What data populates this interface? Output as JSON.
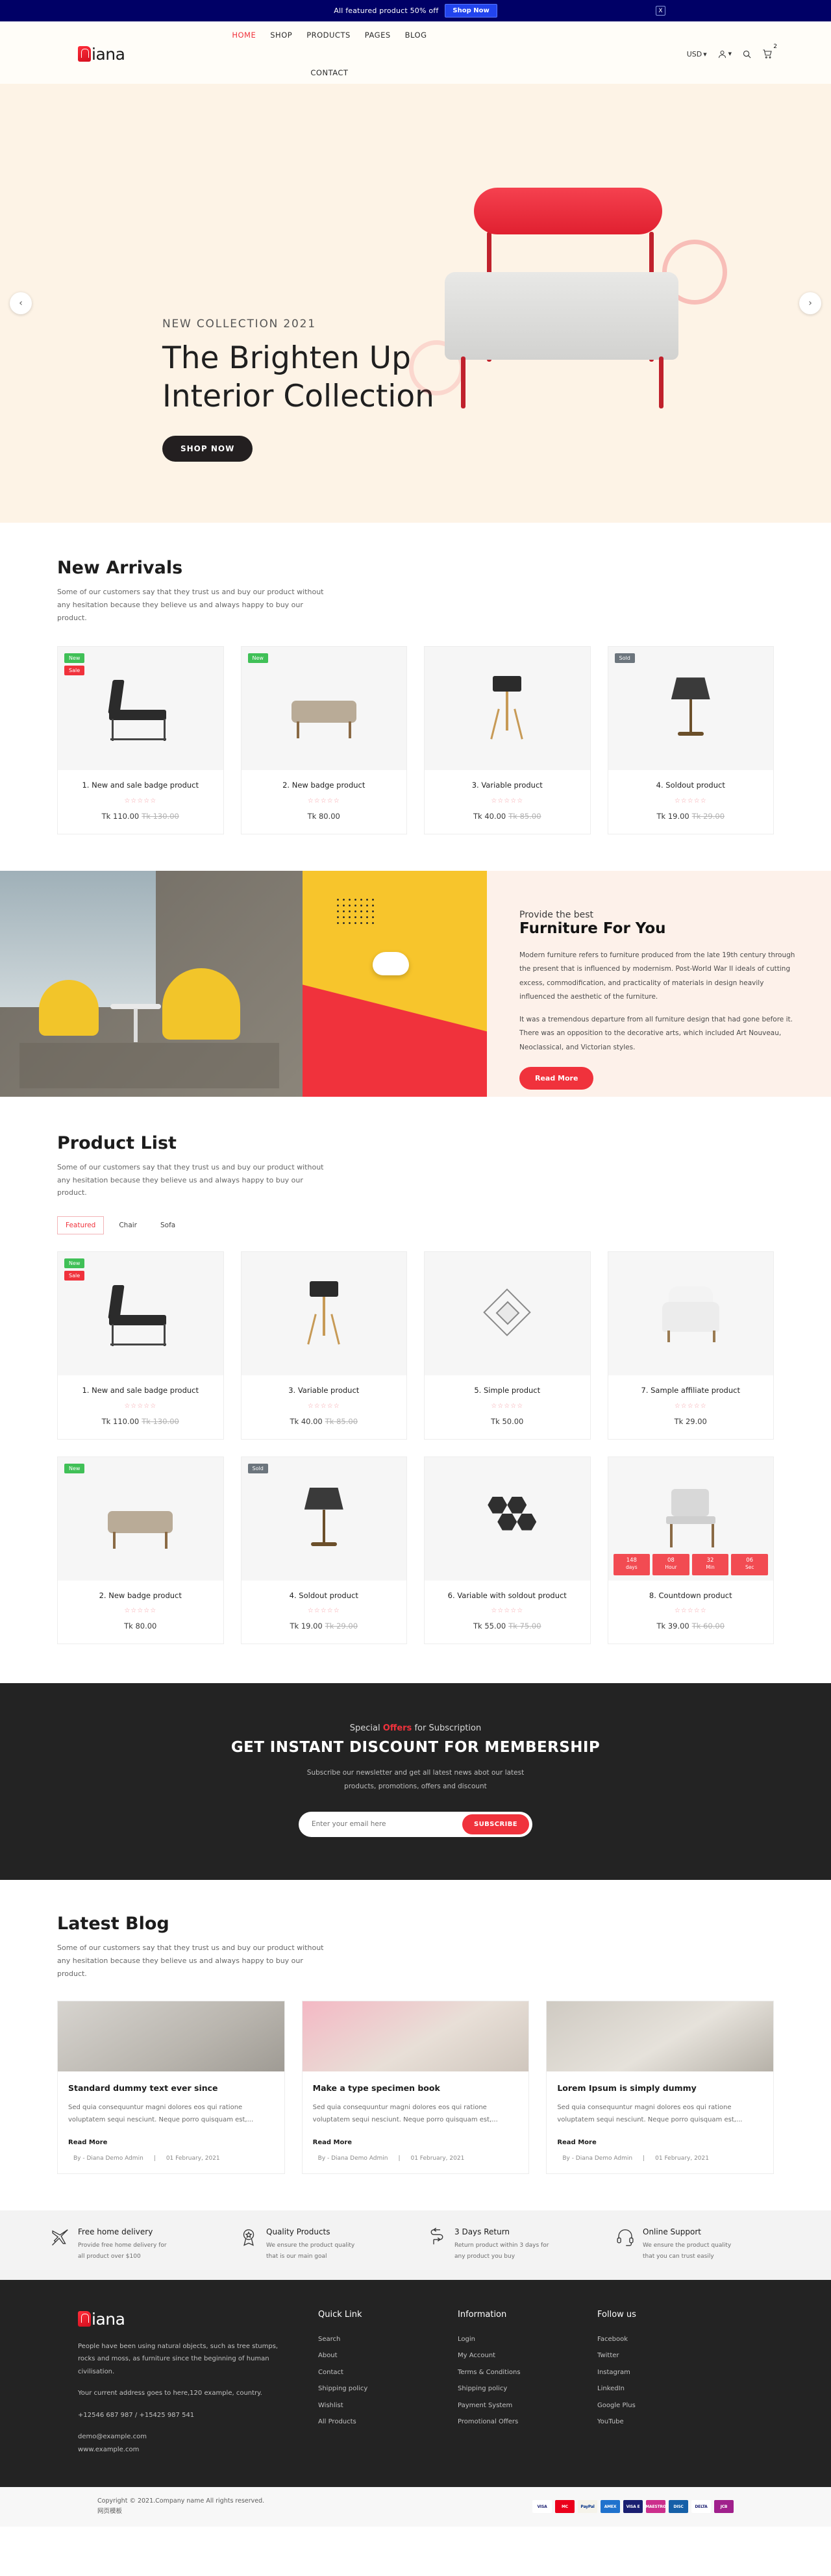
{
  "promo": {
    "text": "All featured product 50% off",
    "button": "Shop Now",
    "close": "X"
  },
  "header": {
    "logo": "iana",
    "nav": [
      {
        "label": "HOME",
        "active": true
      },
      {
        "label": "SHOP",
        "active": false
      },
      {
        "label": "PRODUCTS",
        "active": false
      },
      {
        "label": "PAGES",
        "active": false
      },
      {
        "label": "BLOG",
        "active": false
      },
      {
        "label": "CONTACT",
        "active": false
      }
    ],
    "currency": "USD",
    "cart_count": "2"
  },
  "hero": {
    "eyebrow": "NEW COLLECTION 2021",
    "title_line1": "The Brighten Up",
    "title_line2": "Interior Collection",
    "button": "SHOP NOW",
    "prev": "‹",
    "next": "›"
  },
  "new_arrivals": {
    "title": "New Arrivals",
    "subtitle": "Some of our customers say that they trust us and buy our product without any hesitation because they believe us and always happy to buy our product.",
    "products": [
      {
        "name": "1. New and sale badge product",
        "stars": "☆☆☆☆☆",
        "price": "Tk 110.00",
        "old_price": "Tk 130.00",
        "badges": [
          "New",
          "Sale"
        ]
      },
      {
        "name": "2. New badge product",
        "stars": "☆☆☆☆☆",
        "price": "Tk 80.00",
        "old_price": "",
        "badges": [
          "New"
        ]
      },
      {
        "name": "3. Variable product",
        "stars": "☆☆☆☆☆",
        "price": "Tk 40.00",
        "old_price": "Tk 85.00",
        "badges": []
      },
      {
        "name": "4. Soldout product",
        "stars": "☆☆☆☆☆",
        "price": "Tk 19.00",
        "old_price": "Tk 29.00",
        "badges": [
          "Sold"
        ]
      }
    ]
  },
  "about": {
    "eyebrow": "Provide the best",
    "title": "Furniture For You",
    "paragraph1": "Modern furniture refers to furniture produced from the late 19th century through the present that is influenced by modernism. Post-World War II ideals of cutting excess, commodification, and practicality of materials in design heavily influenced the aesthetic of the furniture.",
    "paragraph2": "It was a tremendous departure from all furniture design that had gone before it. There was an opposition to the decorative arts, which included Art Nouveau, Neoclassical, and Victorian styles.",
    "button": "Read More"
  },
  "product_list": {
    "title": "Product List",
    "subtitle": "Some of our customers say that they trust us and buy our product without any hesitation because they believe us and always happy to buy our product.",
    "tabs": [
      {
        "label": "Featured",
        "active": true
      },
      {
        "label": "Chair",
        "active": false
      },
      {
        "label": "Sofa",
        "active": false
      }
    ],
    "products": [
      {
        "name": "1. New and sale badge product",
        "stars": "☆☆☆☆☆",
        "price": "Tk 110.00",
        "old_price": "Tk 130.00"
      },
      {
        "name": "3. Variable product",
        "stars": "☆☆☆☆☆",
        "price": "Tk 40.00",
        "old_price": "Tk 85.00"
      },
      {
        "name": "5. Simple product",
        "stars": "☆☆☆☆☆",
        "price": "Tk 50.00",
        "old_price": ""
      },
      {
        "name": "7. Sample affiliate product",
        "stars": "☆☆☆☆☆",
        "price": "Tk 29.00",
        "old_price": ""
      },
      {
        "name": "2. New badge product",
        "stars": "☆☆☆☆☆",
        "price": "Tk 80.00",
        "old_price": ""
      },
      {
        "name": "4. Soldout product",
        "stars": "☆☆☆☆☆",
        "price": "Tk 19.00",
        "old_price": "Tk 29.00"
      },
      {
        "name": "6. Variable with soldout product",
        "stars": "☆☆☆☆☆",
        "price": "Tk 55.00",
        "old_price": "Tk 75.00"
      },
      {
        "name": "8. Countdown product",
        "stars": "☆☆☆☆☆",
        "price": "Tk 39.00",
        "old_price": "Tk 60.00"
      }
    ],
    "countdown": [
      {
        "num": "148",
        "label": "days"
      },
      {
        "num": "08",
        "label": "Hour"
      },
      {
        "num": "32",
        "label": "Min"
      },
      {
        "num": "06",
        "label": "Sec"
      }
    ]
  },
  "subscribe": {
    "eyebrow_pre": "Special ",
    "eyebrow_accent": "Offers",
    "eyebrow_post": " for Subscription",
    "title": "GET INSTANT DISCOUNT FOR MEMBERSHIP",
    "desc_line1": "Subscribe our newsletter and get all latest news abot our latest",
    "desc_line2": "products, promotions, offers and discount",
    "placeholder": "Enter your email here",
    "button": "SUBSCRIBE"
  },
  "blog": {
    "title": "Latest Blog",
    "subtitle": "Some of our customers say that they trust us and buy our product without any hesitation because they believe us and always happy to buy our product.",
    "read_more": "Read More",
    "posts": [
      {
        "title": "Standard dummy text ever since",
        "text": "Sed quia consequuntur magni dolores eos qui ratione voluptatem sequi nesciunt. Neque porro quisquam est,...",
        "author": "By - Diana Demo Admin",
        "date": "01 February, 2021"
      },
      {
        "title": "Make a type specimen book",
        "text": "Sed quia consequuntur magni dolores eos qui ratione voluptatem sequi nesciunt. Neque porro quisquam est,...",
        "author": "By - Diana Demo Admin",
        "date": "01 February, 2021"
      },
      {
        "title": "Lorem Ipsum is simply dummy",
        "text": "Sed quia consequuntur magni dolores eos qui ratione voluptatem sequi nesciunt. Neque porro quisquam est,...",
        "author": "By - Diana Demo Admin",
        "date": "01 February, 2021"
      }
    ]
  },
  "features": [
    {
      "icon": "plane-icon",
      "title": "Free home delivery",
      "line1": "Provide free home delivery for",
      "line2": "all product over $100"
    },
    {
      "icon": "award-icon",
      "title": "Quality Products",
      "line1": "We ensure the product quality",
      "line2": "that is our main goal"
    },
    {
      "icon": "return-icon",
      "title": "3 Days Return",
      "line1": "Return product within 3 days for",
      "line2": "any product you buy"
    },
    {
      "icon": "headset-icon",
      "title": "Online Support",
      "line1": "We ensure the product quality",
      "line2": "that you can trust easily"
    }
  ],
  "footer": {
    "logo": "iana",
    "about": "People have been using natural objects, such as tree stumps, rocks and moss, as furniture since the beginning of human civilisation.",
    "address": "Your current address goes to here,120 example, country.",
    "phone": "+12546 687 987 / +15425 987 541",
    "email": "demo@example.com",
    "website": "www.example.com",
    "columns": [
      {
        "head": "Quick Link",
        "links": [
          "Search",
          "About",
          "Contact",
          "Shipping policy",
          "Wishlist",
          "All Products"
        ]
      },
      {
        "head": "Information",
        "links": [
          "Login",
          "My Account",
          "Terms & Conditions",
          "Shipping policy",
          "Payment System",
          "Promotional Offers"
        ]
      },
      {
        "head": "Follow us",
        "links": [
          "Facebook",
          "Twitter",
          "Instagram",
          "LinkedIn",
          "Google Plus",
          "YouTube"
        ]
      }
    ],
    "copyright": "Copyright © 2021.Company name All rights reserved.网页模板",
    "payments": [
      {
        "name": "VISA",
        "bg": "#ffffff",
        "fg": "#1a1f71"
      },
      {
        "name": "MC",
        "bg": "#eb001b",
        "fg": "#ffffff"
      },
      {
        "name": "PayPal",
        "bg": "#f5f3ea",
        "fg": "#003087"
      },
      {
        "name": "AMEX",
        "bg": "#1f72cd",
        "fg": "#ffffff"
      },
      {
        "name": "VISA E",
        "bg": "#1a1f71",
        "fg": "#ffffff"
      },
      {
        "name": "MAESTRO",
        "bg": "#cc2e8c",
        "fg": "#ffffff"
      },
      {
        "name": "DISC",
        "bg": "#1660a8",
        "fg": "#ffffff"
      },
      {
        "name": "DELTA",
        "bg": "#ffffff",
        "fg": "#1a1f71"
      },
      {
        "name": "JCB",
        "bg": "#a0208c",
        "fg": "#ffffff"
      }
    ]
  },
  "colors": {
    "accent_red": "#f0323c",
    "dark": "#232323",
    "hero_bg": "#fdf3e6",
    "promo_bg": "#000066"
  }
}
